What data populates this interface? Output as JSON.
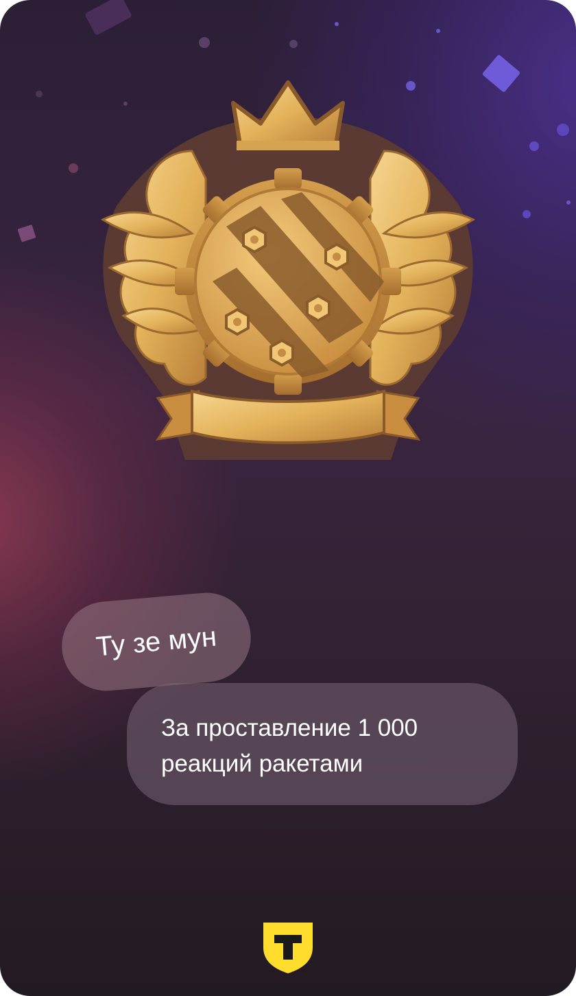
{
  "achievement": {
    "title": "Ту зе мун",
    "description": "За проставление 1 000 реакций ракетами"
  },
  "badge": {
    "icon": "golden-crest-badge-icon"
  },
  "brand": {
    "logo_letter": "T",
    "logo_color": "#ffdd2d"
  },
  "colors": {
    "background_dark": "#2b1f36",
    "accent_purple": "#4a308c",
    "accent_maroon": "#963c55",
    "gold": "#e3b25a"
  }
}
